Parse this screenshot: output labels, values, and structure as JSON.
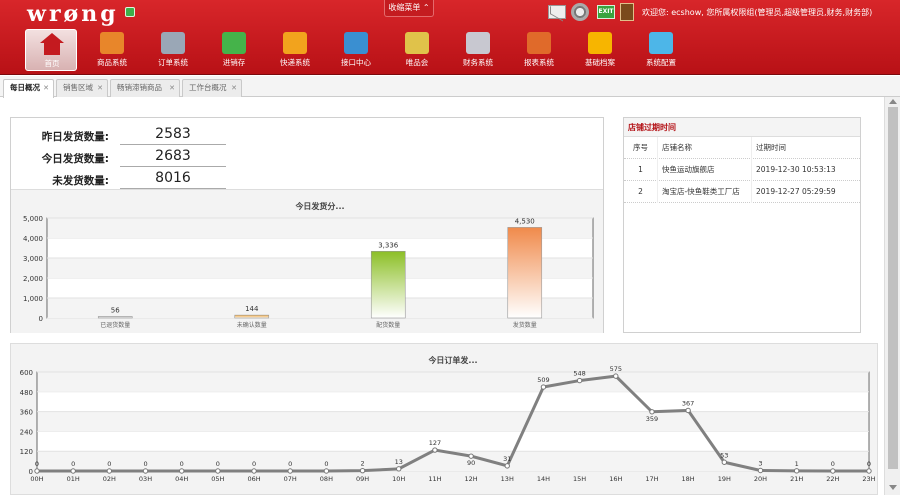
{
  "header": {
    "logo": "wrøng",
    "collapse_menu": "收缩菜单 ⌃",
    "exit_label": "EXIT",
    "welcome": "欢迎您: ecshow, 您所属权限组(管理员,超级管理员,财务,财务部)",
    "colors": {
      "brand": "#c41a1f",
      "accent": "#f08a4b",
      "green": "#8cbf26"
    }
  },
  "nav": [
    {
      "label": "首页",
      "icon": "home-icon",
      "color": "#ffffff",
      "active": true
    },
    {
      "label": "商品系统",
      "icon": "box-icon",
      "color": "#e8862a",
      "active": false
    },
    {
      "label": "订单系统",
      "icon": "order-icon",
      "color": "#9aa7b6",
      "active": false
    },
    {
      "label": "进销存",
      "icon": "cube-icon",
      "color": "#45b34a",
      "active": false
    },
    {
      "label": "快递系统",
      "icon": "truck-icon",
      "color": "#f2a31d",
      "active": false
    },
    {
      "label": "接口中心",
      "icon": "map-icon",
      "color": "#3a8fd1",
      "active": false
    },
    {
      "label": "唯品会",
      "icon": "cart-icon",
      "color": "#e0c24a",
      "active": false
    },
    {
      "label": "财务系统",
      "icon": "finance-icon",
      "color": "#c8c8d0",
      "active": false
    },
    {
      "label": "报表系统",
      "icon": "books-icon",
      "color": "#e06a2a",
      "active": false
    },
    {
      "label": "基础档案",
      "icon": "person-icon",
      "color": "#f7b500",
      "active": false
    },
    {
      "label": "系统配置",
      "icon": "puzzle-icon",
      "color": "#4db6e8",
      "active": false
    }
  ],
  "tabs": [
    {
      "label": "每日概况",
      "active": true
    },
    {
      "label": "销售区域",
      "active": false
    },
    {
      "label": "畅销滞销商品",
      "active": false
    },
    {
      "label": "工作台概况",
      "active": false
    }
  ],
  "stats": {
    "yesterday_label": "昨日发货数量:",
    "yesterday_value": "2583",
    "today_label": "今日发货数量:",
    "today_value": "2683",
    "pending_label": "未发货数量:",
    "pending_value": "8016"
  },
  "expiry": {
    "title": "店铺过期时间",
    "headers": {
      "no": "序号",
      "name": "店铺名称",
      "time": "过期时间"
    },
    "rows": [
      {
        "no": "1",
        "name": "快鱼运动旗舰店",
        "time": "2019-12-30 10:53:13"
      },
      {
        "no": "2",
        "name": "淘宝店-快鱼鞋类工厂店",
        "time": "2019-12-27 05:29:59"
      }
    ]
  },
  "chart_data": [
    {
      "type": "bar",
      "title": "今日发货分...",
      "categories": [
        "已退货数量",
        "未确认数量",
        "配货数量",
        "发货数量"
      ],
      "values": [
        56,
        144,
        3336,
        4530
      ],
      "ylim": [
        0,
        5000
      ],
      "yticks": [
        0,
        1000,
        2000,
        3000,
        4000,
        5000
      ],
      "ytick_labels": [
        "0",
        "1,000",
        "2,000",
        "3,000",
        "4,000",
        "5,000"
      ],
      "value_labels": [
        "56",
        "144",
        "3,336",
        "4,530"
      ],
      "bar_colors": [
        "#bbbbbb",
        "#f0a030",
        "#8cbf26",
        "#f08a4b"
      ]
    },
    {
      "type": "line",
      "title": "今日订单发...",
      "x": [
        "00H",
        "01H",
        "02H",
        "03H",
        "04H",
        "05H",
        "06H",
        "07H",
        "08H",
        "09H",
        "10H",
        "11H",
        "12H",
        "13H",
        "14H",
        "15H",
        "16H",
        "17H",
        "18H",
        "19H",
        "20H",
        "21H",
        "22H",
        "23H"
      ],
      "values": [
        0,
        0,
        0,
        0,
        0,
        0,
        0,
        0,
        0,
        2,
        13,
        127,
        90,
        31,
        509,
        548,
        575,
        359,
        367,
        53,
        3,
        1,
        0,
        0
      ],
      "value_labels": [
        "0",
        "0",
        "0",
        "0",
        "0",
        "0",
        "0",
        "0",
        "0",
        "2",
        "13",
        "127",
        "90",
        "31",
        "509",
        "548",
        "575",
        "359",
        "367",
        "53",
        "3",
        "1",
        "0",
        "0"
      ],
      "ylim": [
        0,
        600
      ],
      "yticks": [
        0,
        120,
        240,
        360,
        480,
        600
      ],
      "line_color": "#808080"
    }
  ]
}
